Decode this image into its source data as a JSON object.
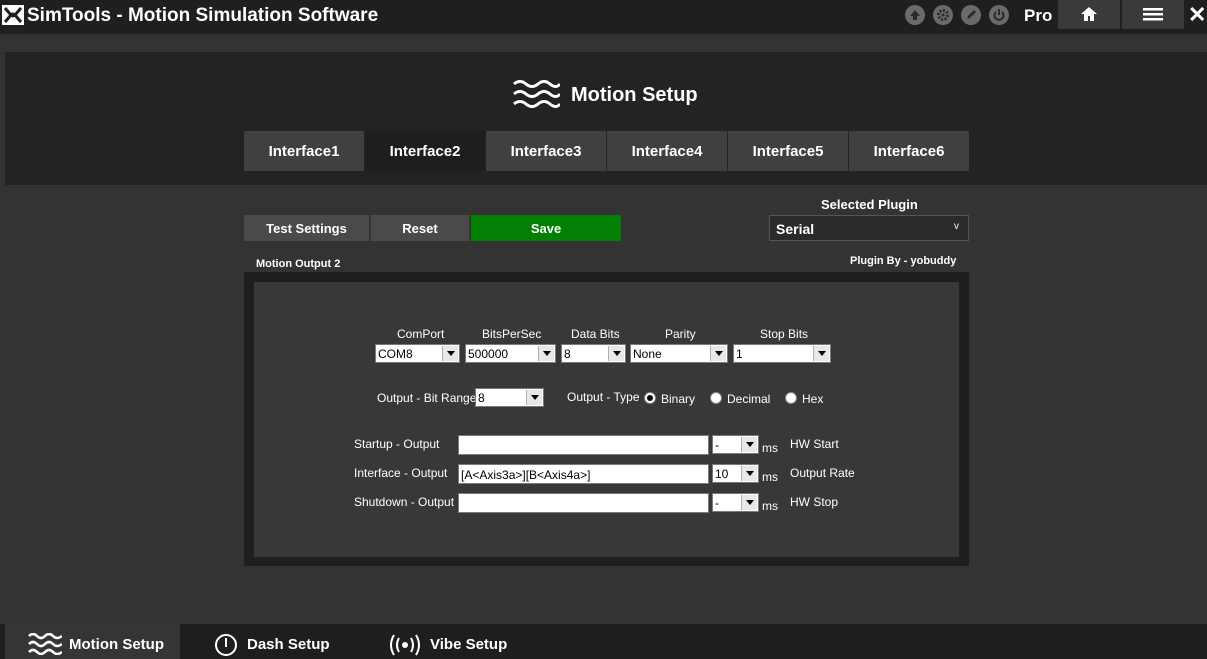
{
  "app": {
    "title": "SimTools - Motion Simulation Software",
    "edition": "Pro"
  },
  "titlebar": {
    "icons": [
      "arrow-up-icon",
      "settings-cog-icon",
      "edit-pencil-icon",
      "power-icon"
    ],
    "home_icon": "home-icon",
    "menu_icon": "hamburger-menu-icon",
    "close_label": "✕"
  },
  "header": {
    "title": "Motion Setup",
    "icon": "waves-icon"
  },
  "tabs": [
    {
      "label": "Interface1",
      "active": false
    },
    {
      "label": "Interface2",
      "active": true
    },
    {
      "label": "Interface3",
      "active": false
    },
    {
      "label": "Interface4",
      "active": false
    },
    {
      "label": "Interface5",
      "active": false
    },
    {
      "label": "Interface6",
      "active": false
    }
  ],
  "actions": {
    "test": "Test Settings",
    "reset": "Reset",
    "save": "Save",
    "save_color": "#038003"
  },
  "plugin": {
    "label": "Selected Plugin",
    "value": "Serial",
    "arrow": "v",
    "by": "Plugin By - yobuddy"
  },
  "output": {
    "title": "Motion Output 2",
    "comport": {
      "label": "ComPort",
      "value": "COM8"
    },
    "bits_per_sec": {
      "label": "BitsPerSec",
      "value": "500000"
    },
    "data_bits": {
      "label": "Data Bits",
      "value": "8"
    },
    "parity": {
      "label": "Parity",
      "value": "None"
    },
    "stop_bits": {
      "label": "Stop Bits",
      "value": "1"
    },
    "bit_range": {
      "label": "Output - Bit Range",
      "value": "8"
    },
    "type": {
      "label": "Output - Type",
      "options": [
        {
          "label": "Binary",
          "selected": true
        },
        {
          "label": "Decimal",
          "selected": false
        },
        {
          "label": "Hex",
          "selected": false
        }
      ]
    },
    "startup": {
      "label": "Startup - Output",
      "value": "",
      "ms_value": "-",
      "unit": "ms",
      "side_label": "HW Start"
    },
    "interface": {
      "label": "Interface - Output",
      "value": "[A<Axis3a>][B<Axis4a>]",
      "ms_value": "10",
      "unit": "ms",
      "side_label": "Output Rate"
    },
    "shutdown": {
      "label": "Shutdown - Output",
      "value": "",
      "ms_value": "-",
      "unit": "ms",
      "side_label": "HW Stop"
    }
  },
  "bottom_nav": [
    {
      "label": "Motion Setup",
      "icon": "waves-icon",
      "active": true
    },
    {
      "label": "Dash Setup",
      "icon": "gauge-icon",
      "active": false
    },
    {
      "label": "Vibe Setup",
      "icon": "vibration-icon",
      "active": false
    }
  ]
}
